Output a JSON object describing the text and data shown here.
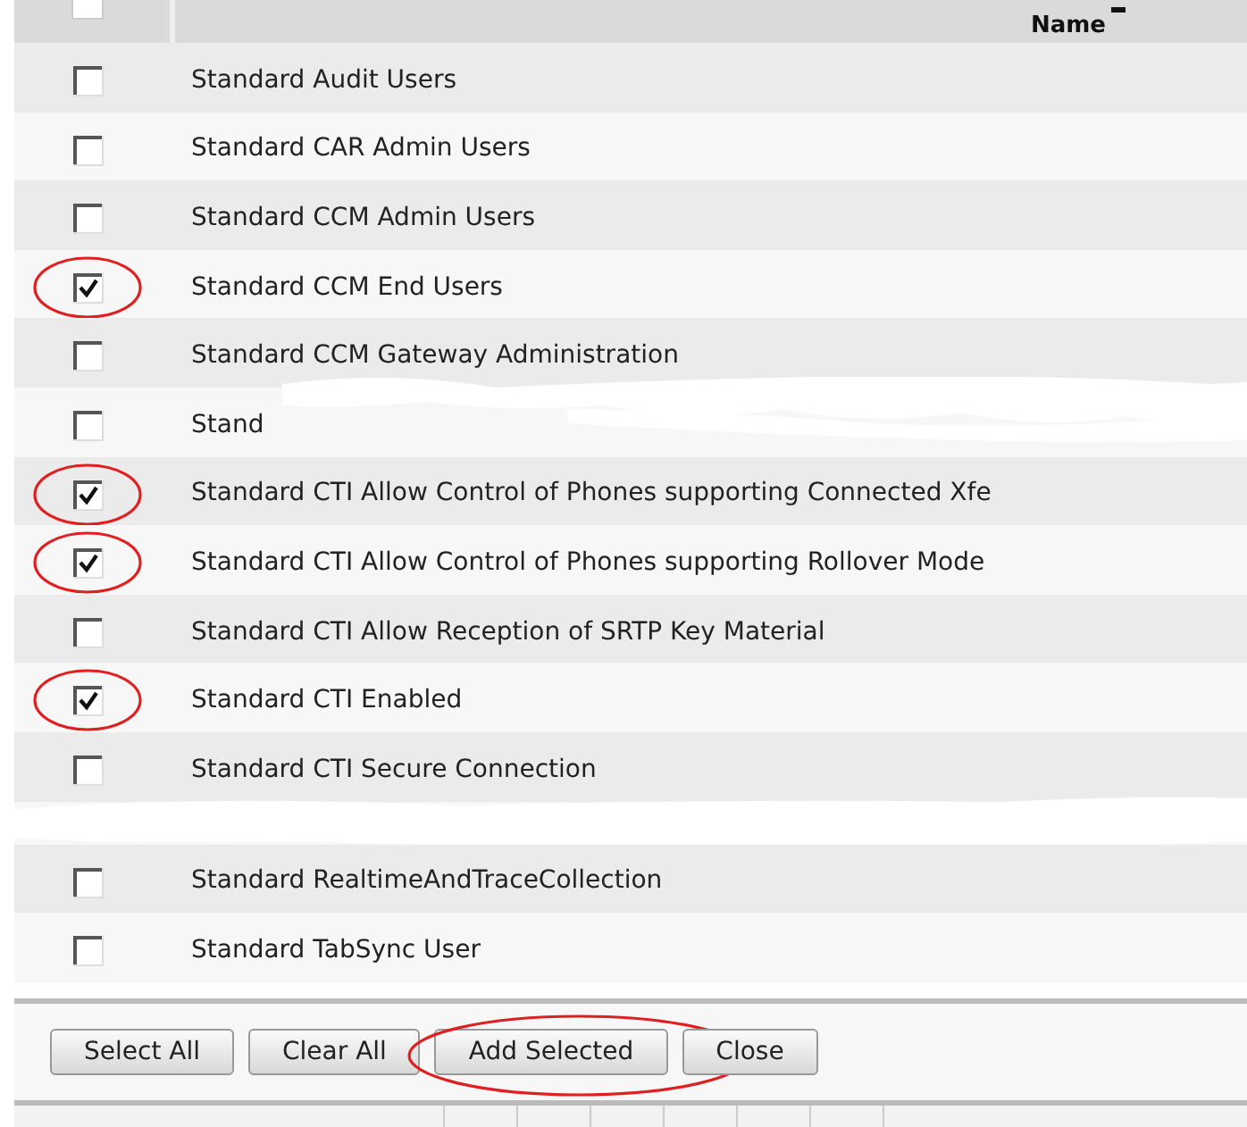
{
  "header": {
    "checked": false,
    "column_2": "Name"
  },
  "rows": [
    {
      "kind": "item",
      "label": "Standard Audit Users",
      "checked": false,
      "circled": false
    },
    {
      "kind": "item",
      "label": "Standard CAR Admin Users",
      "checked": false,
      "circled": false
    },
    {
      "kind": "item",
      "label": "Standard CCM Admin Users",
      "checked": false,
      "circled": false
    },
    {
      "kind": "item",
      "label": "Standard CCM End Users",
      "checked": true,
      "circled": true
    },
    {
      "kind": "item",
      "label": "Standard CCM Gateway Administration",
      "checked": false,
      "circled": false
    },
    {
      "kind": "redacted",
      "label": "Stand",
      "checked": false,
      "circled": false
    },
    {
      "kind": "item",
      "label": "Standard CTI Allow Control of Phones supporting Connected Xfe",
      "checked": true,
      "circled": true
    },
    {
      "kind": "item",
      "label": "Standard CTI Allow Control of Phones supporting Rollover Mode",
      "checked": true,
      "circled": true
    },
    {
      "kind": "item",
      "label": "Standard CTI Allow Reception of SRTP Key Material",
      "checked": false,
      "circled": false
    },
    {
      "kind": "item",
      "label": "Standard CTI Enabled",
      "checked": true,
      "circled": true
    },
    {
      "kind": "item",
      "label": "Standard CTI Secure Connection",
      "checked": false,
      "circled": false
    },
    {
      "kind": "hidden"
    },
    {
      "kind": "item",
      "label": "Standard RealtimeAndTraceCollection",
      "checked": false,
      "circled": false
    },
    {
      "kind": "item",
      "label": "Standard TabSync User",
      "checked": false,
      "circled": false
    }
  ],
  "buttons": [
    {
      "label": "Select All",
      "circled": false
    },
    {
      "label": "Clear All",
      "circled": false
    },
    {
      "label": "Add Selected",
      "circled": true
    },
    {
      "label": "Close",
      "circled": false
    }
  ]
}
